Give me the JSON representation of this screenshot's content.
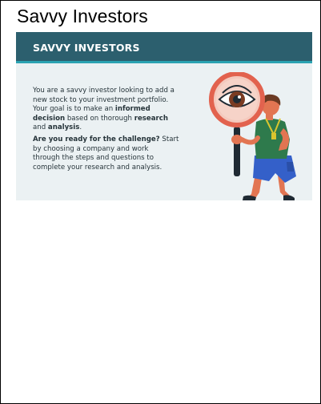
{
  "page": {
    "title": "Savvy Investors"
  },
  "card": {
    "banner_title": "SAVVY INVESTORS",
    "paragraph1": {
      "line1": "You are a savvy investor looking to add a",
      "line2": "new stock to your investment portfolio.",
      "line3_pre": "Your goal is to make an ",
      "line3_bold": "informed",
      "line4_bold": "decision",
      "line4_mid": " based on thorough ",
      "line4_bold2": "research",
      "line5_pre": "and ",
      "line5_bold": "analysis",
      "line5_post": "."
    },
    "paragraph2": {
      "bold": "Are you ready for the challenge?",
      "line1_post": " Start",
      "line2": "by choosing a company and work",
      "line3": "through the steps and questions to",
      "line4": "complete your research and analysis."
    }
  },
  "colors": {
    "banner": "#2c5f6e",
    "banner_accent": "#2ba3b2",
    "card_background": "#ebf1f3",
    "magnifier_frame": "#e2624e",
    "shirt": "#2e7a4c",
    "shorts": "#3460c9"
  },
  "icons": {
    "illustration": "investor-with-magnifying-glass"
  }
}
